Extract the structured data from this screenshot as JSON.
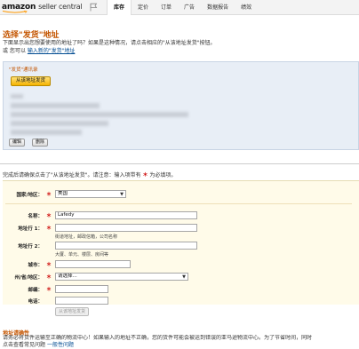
{
  "header": {
    "logo_brand": "amazon",
    "logo_rest": "seller central",
    "nav": [
      "库存",
      "定价",
      "订单",
      "广告",
      "数据报告",
      "绩效"
    ],
    "active_nav": "库存"
  },
  "page": {
    "title": "选择\"发货\"地址",
    "intro_line1": "下面显示出您想要使用的地址了吗？如果是这种情况，请点击相应的\"从该地址发货\"按钮。",
    "intro_line2_prefix": "或 您可以",
    "intro_line2_link": "输入新的\"发货\"地址"
  },
  "saved_address": {
    "label": "\"发货\"通讯录",
    "ship_from_button": "从该地址发货",
    "edit_button": "编辑",
    "delete_button": "删除"
  },
  "form": {
    "notice_prefix": "完成后请确保点击了\"从该地址发货\"。请注意：输入项带有",
    "notice_star": "＊",
    "notice_suffix": "为必填项。",
    "required_mark": "＊",
    "country_label": "国家/地区：",
    "country_value": "美国",
    "name_label": "名称：",
    "name_value": "Lafedy",
    "address1_label": "地址行 1：",
    "address1_value": "",
    "address1_hint": "街道地址，邮政信箱，公司名称",
    "address2_label": "地址行 2：",
    "address2_value": "",
    "address2_hint": "大厦、单元、楼层、房间等",
    "city_label": "城市：",
    "city_value": "",
    "state_label": "州/省/地区：",
    "state_value": "请选择...",
    "zip_label": "邮编：",
    "zip_value": "",
    "phone_label": "电话：",
    "phone_value": "",
    "ship_from_button": "从该地址发货"
  },
  "footer": {
    "title": "地址请确性",
    "text": "请务必将货件运输至正确的物流中心！如果输入的地址不正确，您的货件可能会被运到错误的亚马逊物流中心。为了节省时间，同时",
    "link_prefix": "点击查看常见问题",
    "link": "一般性问题"
  },
  "colors": {
    "accent_orange": "#c45500",
    "link_blue": "#004b91",
    "required_red": "#cc0000",
    "saved_box_bg": "#e8eef6",
    "form_bg": "#fffbe9"
  }
}
